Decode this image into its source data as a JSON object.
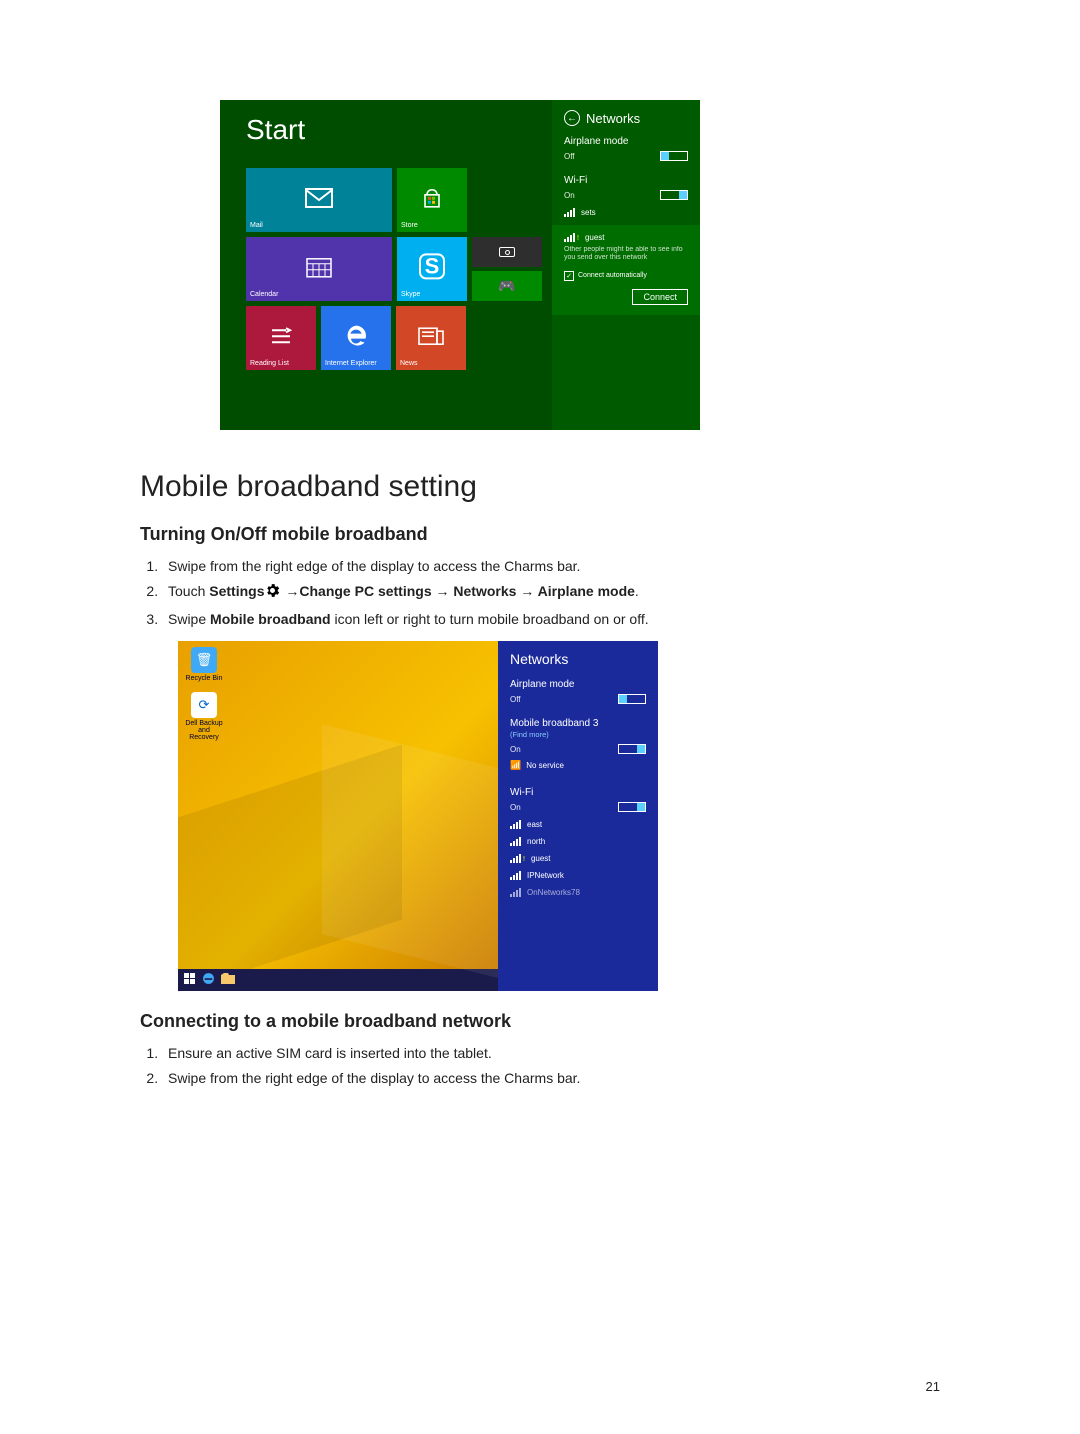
{
  "pageNumber": "21",
  "doc": {
    "h1": "Mobile broadband setting",
    "sec1": {
      "h2": "Turning On/Off mobile broadband",
      "li1": "Swipe from the right edge of the display to access the Charms bar.",
      "li2_a": "Touch ",
      "li2_b_bold": "Settings",
      "li2_c": " →",
      "li2_d_bold": "Change PC settings → Networks → Airplane mode",
      "li2_e": ".",
      "li3_a": "Swipe ",
      "li3_b_bold": "Mobile broadband",
      "li3_c": " icon left or right to turn mobile broadband on or off."
    },
    "sec2": {
      "h2": "Connecting to a mobile broadband network",
      "li1": "Ensure an active SIM card is inserted into the tablet.",
      "li2": "Swipe from the right edge of the display to access the Charms bar."
    }
  },
  "shot1": {
    "start": "Start",
    "tiles": {
      "mail": "Mail",
      "store": "Store",
      "calendar": "Calendar",
      "skype": "Skype",
      "reading": "Reading List",
      "ie": "Internet Explorer",
      "news": "News"
    },
    "networks": {
      "title": "Networks",
      "airplane": "Airplane mode",
      "airplane_state": "Off",
      "wifi": "Wi-Fi",
      "wifi_state": "On",
      "item_sets": "sets",
      "item_guest": "guest",
      "hint": "Other people might be able to see info you send over this network",
      "auto": "Connect automatically",
      "connect": "Connect"
    }
  },
  "shot2": {
    "desktop": {
      "icon1": "Recycle Bin",
      "icon2": "Dell Backup and Recovery"
    },
    "networks": {
      "title": "Networks",
      "airplane": "Airplane mode",
      "airplane_state": "Off",
      "mbb": "Mobile broadband 3",
      "findmore": "(Find more)",
      "mbb_state": "On",
      "noservice": "No service",
      "wifi": "Wi-Fi",
      "wifi_state": "On",
      "n1": "east",
      "n2": "north",
      "n3": "guest",
      "n4": "IPNetwork",
      "n5": "OnNetworks78"
    }
  }
}
